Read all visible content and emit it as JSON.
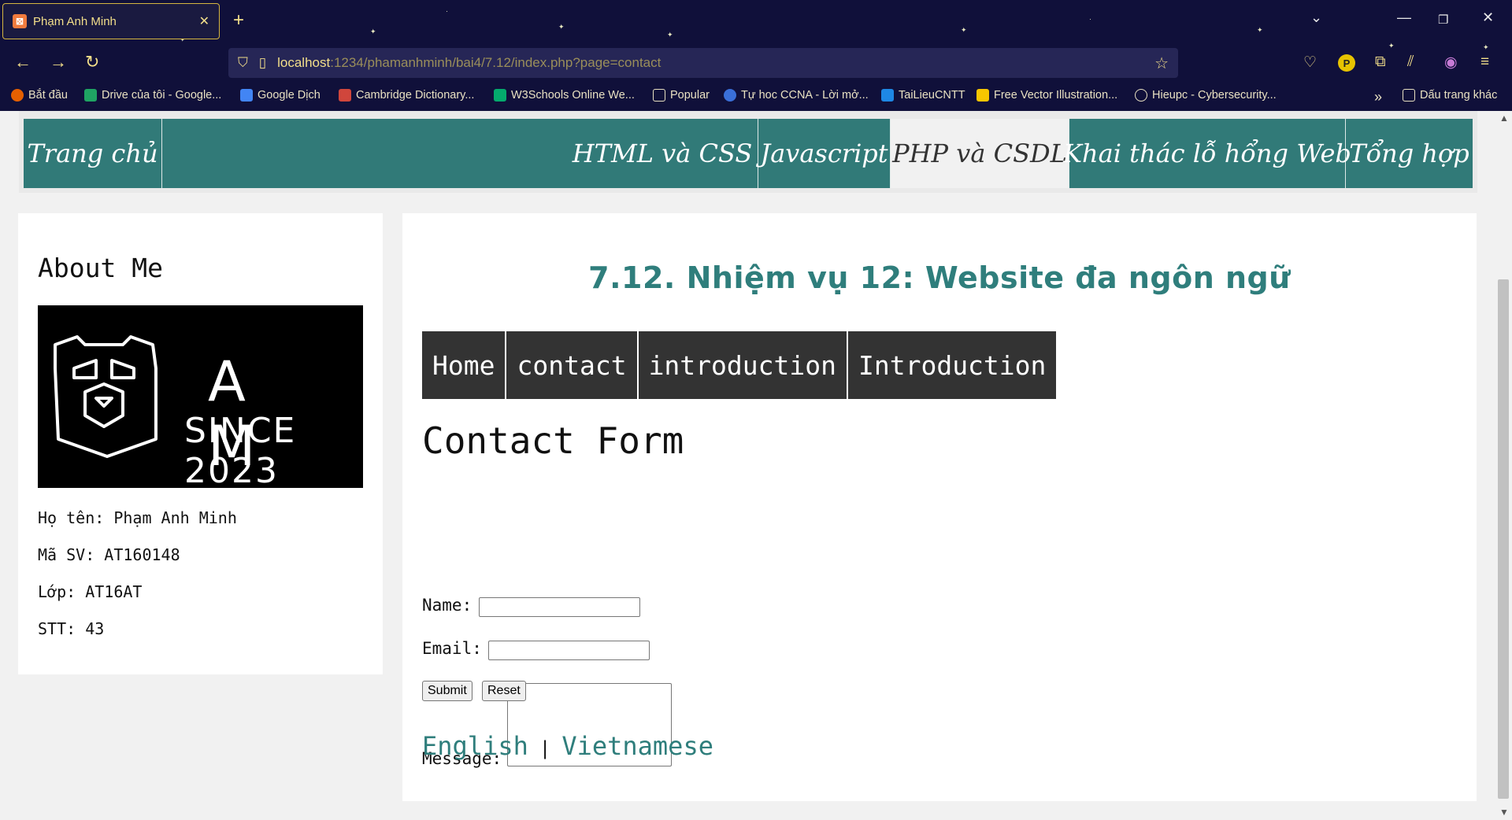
{
  "browser": {
    "tab_title": "Phạm Anh Minh",
    "tab_close": "✕",
    "new_tab": "+",
    "url_host": "localhost",
    "url_path": ":1234/phamanhminh/bai4/7.12/index.php?page=contact",
    "profile_letter": "P",
    "bookmarks": [
      {
        "label": "Bắt đầu",
        "icon": "firefox-icon",
        "color": "#e66000"
      },
      {
        "label": "Drive của tôi - Google...",
        "icon": "google-drive-icon",
        "color": "#1fa463"
      },
      {
        "label": "Google Dịch",
        "icon": "google-translate-icon",
        "color": "#4285f4"
      },
      {
        "label": "Cambridge Dictionary...",
        "icon": "cambridge-icon",
        "color": "#d0463c"
      },
      {
        "label": "W3Schools Online We...",
        "icon": "w3schools-icon",
        "color": "#04aa6d"
      },
      {
        "label": "Popular",
        "icon": "folder-icon",
        "color": "#e9e1c2"
      },
      {
        "label": "Tự hoc CCNA - Lời mở...",
        "icon": "ccna-icon",
        "color": "#3a6fd8"
      },
      {
        "label": "TaiLieuCNTT",
        "icon": "tailieucntt-icon",
        "color": "#1e88e5"
      },
      {
        "label": "Free Vector Illustration...",
        "icon": "freepik-icon",
        "color": "#f7c600"
      },
      {
        "label": "Hieupc - Cybersecurity...",
        "icon": "globe-icon",
        "color": "#e9e1c2"
      }
    ],
    "overflow_bookmarks": "Dấu trang khác"
  },
  "topnav": {
    "home": "Trang chủ",
    "items": [
      "HTML và CSS",
      "Javascript",
      "PHP và CSDL",
      "Khai thác lỗ hổng Web",
      "Tổng hợp"
    ],
    "active": "PHP và CSDL"
  },
  "sidebar": {
    "title": "About Me",
    "logo_text_top": "A  M",
    "logo_text_bottom": "SINCE 2023",
    "info": [
      {
        "label": "Họ tên:",
        "value": "Phạm Anh Minh"
      },
      {
        "label": "Mã SV:",
        "value": "AT160148"
      },
      {
        "label": "Lớp:",
        "value": "AT16AT"
      },
      {
        "label": "STT:",
        "value": "43"
      }
    ]
  },
  "main": {
    "heading": "7.12. Nhiệm vụ 12: Website đa ngôn ngữ",
    "subnav": [
      "Home",
      "contact",
      "introduction",
      "Introduction"
    ],
    "form_title": "Contact Form",
    "name_label": "Name:",
    "email_label": "Email:",
    "message_label": "Message:",
    "name_value": "",
    "email_value": "",
    "message_value": "",
    "submit": "Submit",
    "reset": "Reset",
    "lang_en": "English",
    "lang_sep": "|",
    "lang_vi": "Vietnamese"
  },
  "colors": {
    "accent": "#317a78",
    "heading": "#2f7e7c",
    "chrome_bg": "#10103a",
    "chrome_text": "#f3df8a"
  }
}
